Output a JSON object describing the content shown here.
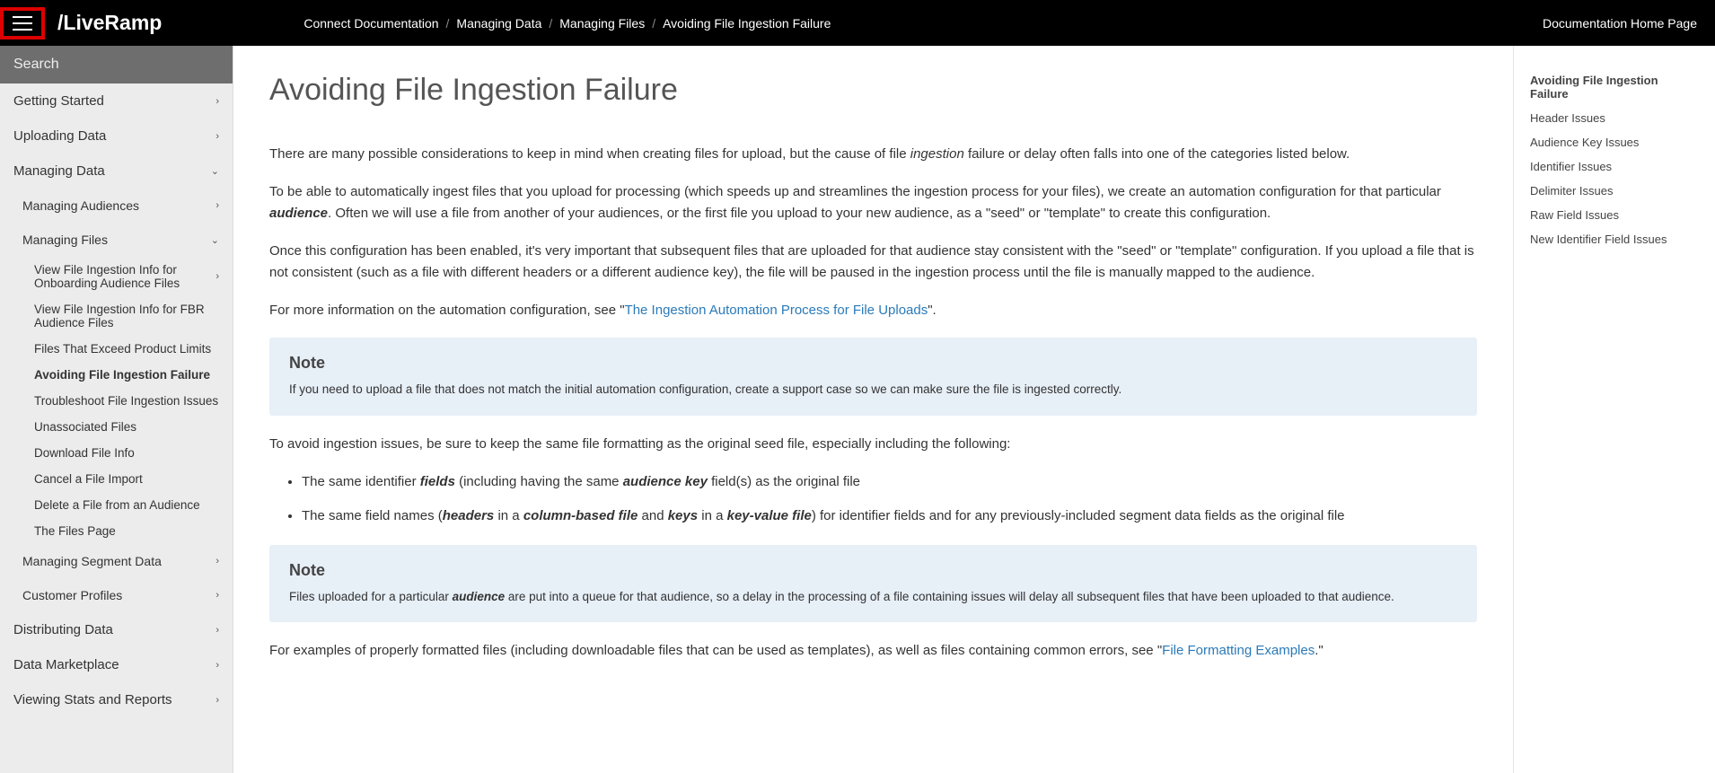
{
  "header": {
    "logo": "/LiveRamp",
    "breadcrumb": [
      "Connect Documentation",
      "Managing Data",
      "Managing Files",
      "Avoiding File Ingestion Failure"
    ],
    "home_link": "Documentation Home Page"
  },
  "sidebar": {
    "search_placeholder": "Search",
    "items": [
      {
        "label": "Getting Started",
        "level": 0,
        "arrow": "right"
      },
      {
        "label": "Uploading Data",
        "level": 0,
        "arrow": "right"
      },
      {
        "label": "Managing Data",
        "level": 0,
        "arrow": "down"
      },
      {
        "label": "Managing Audiences",
        "level": 1,
        "arrow": "right"
      },
      {
        "label": "Managing Files",
        "level": 1,
        "arrow": "down"
      },
      {
        "label": "View File Ingestion Info for Onboarding Audience Files",
        "level": 2,
        "arrow": "right"
      },
      {
        "label": "View File Ingestion Info for FBR Audience Files",
        "level": 2
      },
      {
        "label": "Files That Exceed Product Limits",
        "level": 2
      },
      {
        "label": "Avoiding File Ingestion Failure",
        "level": 2,
        "active": true
      },
      {
        "label": "Troubleshoot File Ingestion Issues",
        "level": 2
      },
      {
        "label": "Unassociated Files",
        "level": 2
      },
      {
        "label": "Download File Info",
        "level": 2
      },
      {
        "label": "Cancel a File Import",
        "level": 2
      },
      {
        "label": "Delete a File from an Audience",
        "level": 2
      },
      {
        "label": "The Files Page",
        "level": 2
      },
      {
        "label": "Managing Segment Data",
        "level": 1,
        "arrow": "right"
      },
      {
        "label": "Customer Profiles",
        "level": 1,
        "arrow": "right"
      },
      {
        "label": "Distributing Data",
        "level": 0,
        "arrow": "right"
      },
      {
        "label": "Data Marketplace",
        "level": 0,
        "arrow": "right"
      },
      {
        "label": "Viewing Stats and Reports",
        "level": 0,
        "arrow": "right"
      }
    ]
  },
  "content": {
    "title": "Avoiding File Ingestion Failure",
    "p1_a": "There are many possible considerations to keep in mind when creating files for upload, but the cause of file ",
    "p1_em1": "ingestion",
    "p1_b": " failure or delay often falls into one of the categories listed below.",
    "p2_a": "To be able to automatically ingest files that you upload for processing (which speeds up and streamlines the ingestion process for your files), we create an automation configuration for that particular ",
    "p2_em1": "audience",
    "p2_b": ". Often we will use a file from another of your audiences, or the first file you upload to your new audience, as a \"seed\" or \"template\" to create this configuration.",
    "p3": "Once this configuration has been enabled, it's very important that subsequent files that are uploaded for that audience stay consistent with the \"seed\" or \"template\" configuration. If you upload a file that is not consistent (such as a file with different headers or a different audience key), the file will be paused in the ingestion process until the file is manually mapped to the audience.",
    "p4_a": "For more information on the automation configuration, see \"",
    "p4_link": "The Ingestion Automation Process for File Uploads",
    "p4_b": "\".",
    "note1_title": "Note",
    "note1_body": "If you need to upload a file that does not match the initial automation configuration, create a support case so we can make sure the file is ingested correctly.",
    "p5": "To avoid ingestion issues, be sure to keep the same file formatting as the original seed file, especially including the following:",
    "li1_a": "The same identifier ",
    "li1_em1": "fields",
    "li1_b": " (including having the same ",
    "li1_em2": "audience key",
    "li1_c": " field(s) as the original file",
    "li2_a": "The same field names (",
    "li2_em1": "headers",
    "li2_b": " in a ",
    "li2_em2": "column-based file",
    "li2_c": " and ",
    "li2_em3": "keys",
    "li2_d": " in a ",
    "li2_em4": "key-value file",
    "li2_e": ") for identifier fields and for any previously-included segment data fields as the original file",
    "note2_title": "Note",
    "note2_body_a": "Files uploaded for a particular ",
    "note2_body_em": "audience",
    "note2_body_b": " are put into a queue for that audience, so a delay in the processing of a file containing issues will delay all subsequent files that have been uploaded to that audience.",
    "p6_a": "For examples of properly formatted files (including downloadable files that can be used as templates), as well as files containing common errors, see \"",
    "p6_link": "File Formatting Examples",
    "p6_b": ".\""
  },
  "toc": [
    {
      "label": "Avoiding File Ingestion Failure",
      "active": true
    },
    {
      "label": "Header Issues"
    },
    {
      "label": "Audience Key Issues"
    },
    {
      "label": "Identifier Issues"
    },
    {
      "label": "Delimiter Issues"
    },
    {
      "label": "Raw Field Issues"
    },
    {
      "label": "New Identifier Field Issues"
    }
  ]
}
